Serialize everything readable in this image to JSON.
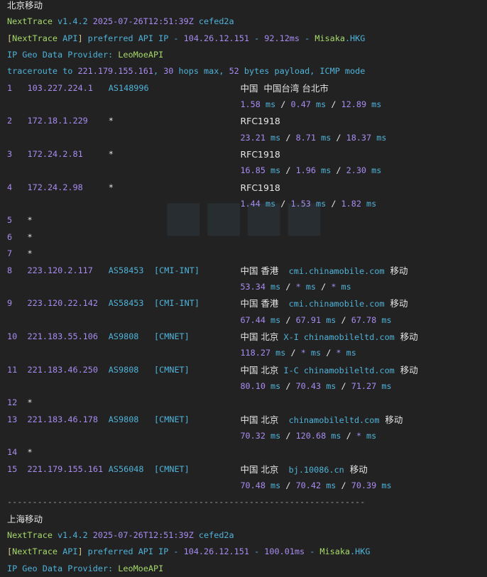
{
  "colors": {
    "background": "#222222",
    "green": "#a6d96a",
    "cyan": "#4fb3d9",
    "purple": "#a88cf2",
    "white": "#e6e6e6"
  },
  "sections": [
    {
      "title": "北京移动",
      "header": [
        [
          {
            "t": "NextTrace ",
            "c": "g"
          },
          {
            "t": "v1.4.2 ",
            "c": "c"
          },
          {
            "t": "2025-07-26T12:51:39Z ",
            "c": "p"
          },
          {
            "t": "cefed2a",
            "c": "c"
          }
        ],
        [
          {
            "t": "[",
            "c": "y"
          },
          {
            "t": "NextTrace",
            "c": "g"
          },
          {
            "t": " API",
            "c": "c"
          },
          {
            "t": "] ",
            "c": "y"
          },
          {
            "t": "preferred API IP - ",
            "c": "c"
          },
          {
            "t": "104.26.12.151",
            "c": "p"
          },
          {
            "t": " - ",
            "c": "c"
          },
          {
            "t": "92.12ms",
            "c": "p"
          },
          {
            "t": " - ",
            "c": "c"
          },
          {
            "t": "Misaka",
            "c": "g"
          },
          {
            "t": ".HKG",
            "c": "c"
          }
        ],
        [
          {
            "t": "IP Geo Data Provider: ",
            "c": "c"
          },
          {
            "t": "LeoMoeAPI",
            "c": "g"
          }
        ],
        [
          {
            "t": "traceroute to ",
            "c": "c"
          },
          {
            "t": "221.179.155.161",
            "c": "p"
          },
          {
            "t": ", ",
            "c": "c"
          },
          {
            "t": "30",
            "c": "p"
          },
          {
            "t": " hops max, ",
            "c": "c"
          },
          {
            "t": "52",
            "c": "p"
          },
          {
            "t": " bytes payload, ICMP mode",
            "c": "c"
          }
        ]
      ],
      "hops": [
        {
          "hop": "1",
          "ip": "103.227.224.1",
          "asn": "AS148996",
          "tag": "",
          "geo": "中国  中国台湾 台北市",
          "host": "",
          "isp": "",
          "latency": [
            "1.58",
            "0.47",
            "12.89"
          ]
        },
        {
          "hop": "2",
          "ip": "172.18.1.229",
          "asn": "*",
          "tag": "",
          "geo": "RFC1918",
          "host": "",
          "isp": "",
          "latency": [
            "23.21",
            "8.71",
            "18.37"
          ]
        },
        {
          "hop": "3",
          "ip": "172.24.2.81",
          "asn": "*",
          "tag": "",
          "geo": "RFC1918",
          "host": "",
          "isp": "",
          "latency": [
            "16.85",
            "1.96",
            "2.30"
          ]
        },
        {
          "hop": "4",
          "ip": "172.24.2.98",
          "asn": "*",
          "tag": "",
          "geo": "RFC1918",
          "host": "",
          "isp": "",
          "latency": [
            "1.44",
            "1.53",
            "1.82"
          ]
        },
        {
          "hop": "5",
          "ip": "*"
        },
        {
          "hop": "6",
          "ip": "*"
        },
        {
          "hop": "7",
          "ip": "*"
        },
        {
          "hop": "8",
          "ip": "223.120.2.117",
          "asn": "AS58453",
          "tag": "[CMI-INT]",
          "geo": "中国 香港",
          "host": "  cmi.chinamobile.com",
          "isp": "  移动",
          "latency": [
            "53.34",
            "*",
            "*"
          ]
        },
        {
          "hop": "9",
          "ip": "223.120.22.142",
          "asn": "AS58453",
          "tag": "[CMI-INT]",
          "geo": "中国 香港",
          "host": "  cmi.chinamobile.com",
          "isp": "  移动",
          "latency": [
            "67.44",
            "67.91",
            "67.78"
          ]
        },
        {
          "hop": "10",
          "ip": "221.183.55.106",
          "asn": "AS9808",
          "tag": "[CMNET]",
          "geo": "中国 北京",
          "host": " X-I chinamobileltd.com",
          "isp": "  移动",
          "latency": [
            "118.27",
            "*",
            "*"
          ]
        },
        {
          "hop": "11",
          "ip": "221.183.46.250",
          "asn": "AS9808",
          "tag": "[CMNET]",
          "geo": "中国 北京",
          "host": " I-C chinamobileltd.com",
          "isp": "  移动",
          "latency": [
            "80.10",
            "70.43",
            "71.27"
          ]
        },
        {
          "hop": "12",
          "ip": "*"
        },
        {
          "hop": "13",
          "ip": "221.183.46.178",
          "asn": "AS9808",
          "tag": "[CMNET]",
          "geo": "中国 北京",
          "host": "  chinamobileltd.com",
          "isp": "  移动",
          "latency": [
            "70.32",
            "120.68",
            "*"
          ]
        },
        {
          "hop": "14",
          "ip": "*"
        },
        {
          "hop": "15",
          "ip": "221.179.155.161",
          "asn": "AS56048",
          "tag": "[CMNET]",
          "geo": "中国 北京",
          "host": "  bj.10086.cn",
          "isp": "  移动",
          "latency": [
            "70.48",
            "70.42",
            "70.39"
          ]
        }
      ]
    }
  ],
  "separator": "-----------------------------------------------------------------------",
  "section2": {
    "title": "上海移动",
    "header": [
      [
        {
          "t": "NextTrace ",
          "c": "g"
        },
        {
          "t": "v1.4.2 ",
          "c": "c"
        },
        {
          "t": "2025-07-26T12:51:39Z ",
          "c": "p"
        },
        {
          "t": "cefed2a",
          "c": "c"
        }
      ],
      [
        {
          "t": "[",
          "c": "y"
        },
        {
          "t": "NextTrace",
          "c": "g"
        },
        {
          "t": " API",
          "c": "c"
        },
        {
          "t": "] ",
          "c": "y"
        },
        {
          "t": "preferred API IP - ",
          "c": "c"
        },
        {
          "t": "104.26.12.151",
          "c": "p"
        },
        {
          "t": " - ",
          "c": "c"
        },
        {
          "t": "100.01ms",
          "c": "p"
        },
        {
          "t": " - ",
          "c": "c"
        },
        {
          "t": "Misaka",
          "c": "g"
        },
        {
          "t": ".HKG",
          "c": "c"
        }
      ],
      [
        {
          "t": "IP Geo Data Provider: ",
          "c": "c"
        },
        {
          "t": "LeoMoeAPI",
          "c": "g"
        }
      ]
    ]
  },
  "latency_unit": "ms",
  "latency_sep": " / "
}
